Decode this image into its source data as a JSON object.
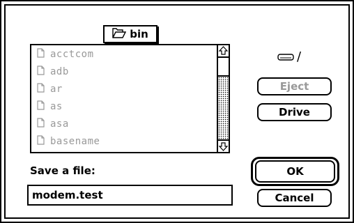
{
  "dialog": {
    "folder_popup": {
      "label": "bin",
      "icon": "open-folder-icon"
    },
    "file_list": {
      "items": [
        {
          "name": "acctcom",
          "icon": "document-icon"
        },
        {
          "name": "adb",
          "icon": "document-icon"
        },
        {
          "name": "ar",
          "icon": "document-icon"
        },
        {
          "name": "as",
          "icon": "document-icon"
        },
        {
          "name": "asa",
          "icon": "document-icon"
        },
        {
          "name": "basename",
          "icon": "document-icon"
        }
      ]
    },
    "volume": {
      "icon": "floppy-disk-icon",
      "name": "/"
    },
    "buttons": {
      "eject": "Eject",
      "drive": "Drive",
      "ok": "OK",
      "cancel": "Cancel"
    },
    "save_prompt": "Save a file:",
    "filename_value": "modem.test"
  }
}
